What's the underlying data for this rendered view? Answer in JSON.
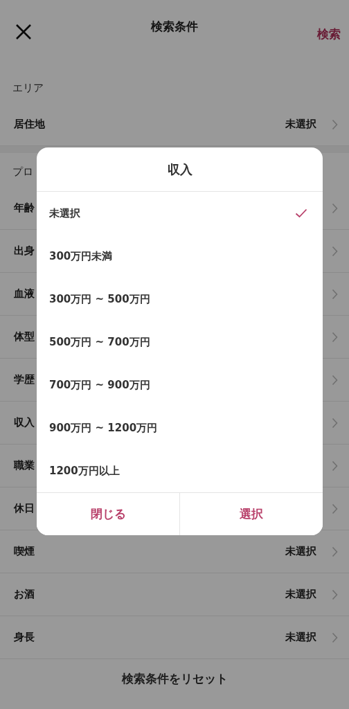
{
  "header": {
    "title": "検索条件",
    "action": "検索"
  },
  "sections": [
    {
      "heading": "エリア",
      "rows": [
        {
          "label": "居住地",
          "value": "未選択"
        }
      ]
    },
    {
      "heading": "プロ",
      "rows": [
        {
          "label": "年齢"
        },
        {
          "label": "出身"
        },
        {
          "label": "血液"
        },
        {
          "label": "体型"
        },
        {
          "label": "学歴"
        },
        {
          "label": "収入"
        },
        {
          "label": "職業"
        },
        {
          "label": "休日"
        },
        {
          "label": "喫煙",
          "value": "未選択"
        },
        {
          "label": "お酒",
          "value": "未選択"
        },
        {
          "label": "身長",
          "value": "未選択"
        }
      ]
    }
  ],
  "reset_button": "検索条件をリセット",
  "dialog": {
    "title": "収入",
    "options": [
      {
        "label": "未選択",
        "selected": true
      },
      {
        "label": "300万円未満",
        "selected": false
      },
      {
        "label": "300万円 ~ 500万円",
        "selected": false
      },
      {
        "label": "500万円 ~ 700万円",
        "selected": false
      },
      {
        "label": "700万円 ~ 900万円",
        "selected": false
      },
      {
        "label": "900万円 ~ 1200万円",
        "selected": false
      },
      {
        "label": "1200万円以上",
        "selected": false
      }
    ],
    "buttons": [
      "閉じる",
      "選択"
    ]
  }
}
